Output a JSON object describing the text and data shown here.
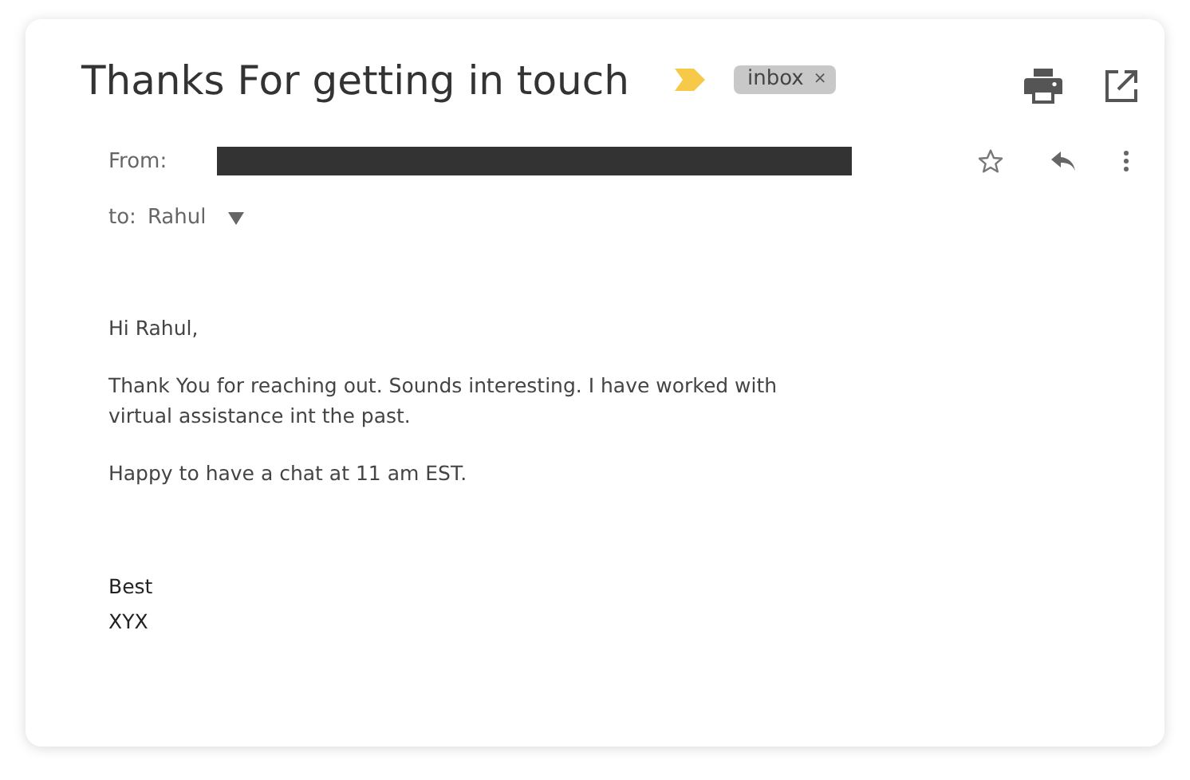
{
  "email": {
    "subject": "Thanks For getting in touch",
    "important": true,
    "labels": [
      {
        "text": "inbox",
        "close": "×"
      }
    ],
    "from_label": "From:",
    "sender_redacted": true,
    "to_label": "to:",
    "to_name": "Rahul",
    "body": [
      {
        "kind": "para",
        "lines": [
          "Hi Rahul,"
        ]
      },
      {
        "kind": "para",
        "lines": [
          "Thank You for reaching out. Sounds interesting. I have worked with",
          "virtual assistance int the past."
        ]
      },
      {
        "kind": "para",
        "lines": [
          "Happy to have a chat at 11 am EST."
        ]
      },
      {
        "kind": "gap"
      },
      {
        "kind": "signoff",
        "lines": [
          "Best",
          "XYX"
        ]
      }
    ]
  }
}
